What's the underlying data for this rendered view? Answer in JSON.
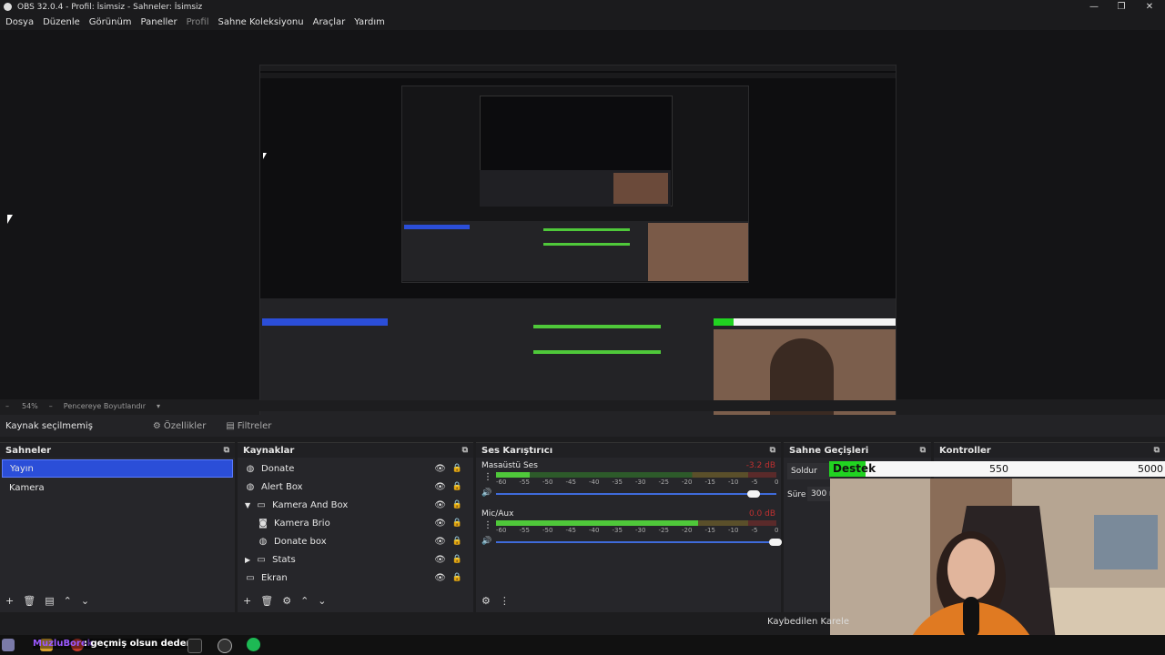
{
  "window": {
    "title": "OBS 32.0.4 - Profil: İsimsiz - Sahneler: İsimsiz"
  },
  "menu": [
    "Dosya",
    "Düzenle",
    "Görünüm",
    "Paneller",
    "Profil",
    "Sahne Koleksiyonu",
    "Araçlar",
    "Yardım"
  ],
  "zoom": {
    "value": "54%",
    "mode": "Pencereye Boyutlandır"
  },
  "source_bar": {
    "status": "Kaynak seçilmemiş",
    "properties": "Özellikler",
    "filters": "Filtreler"
  },
  "docks": {
    "scenes": {
      "title": "Sahneler",
      "items": [
        "Yayın",
        "Kamera"
      ],
      "selected": "Yayın"
    },
    "sources": {
      "title": "Kaynaklar",
      "items": [
        {
          "label": "Donate",
          "icon": "browser-icon",
          "indent": 0
        },
        {
          "label": "Alert Box",
          "icon": "browser-icon",
          "indent": 0
        },
        {
          "label": "Kamera And Box",
          "icon": "folder-icon",
          "indent": 0,
          "expanded": true
        },
        {
          "label": "Kamera Brio",
          "icon": "camera-icon",
          "indent": 1
        },
        {
          "label": "Donate box",
          "icon": "browser-icon",
          "indent": 1
        },
        {
          "label": "Stats",
          "icon": "folder-icon",
          "indent": 0,
          "expanded": false
        },
        {
          "label": "Ekran",
          "icon": "monitor-icon",
          "indent": 0
        }
      ]
    },
    "mixer": {
      "title": "Ses Karıştırıcı",
      "channels": [
        {
          "name": "Masaüstü Ses",
          "db": "-3.2 dB",
          "level": 0.12,
          "fader": 0.92
        },
        {
          "name": "Mic/Aux",
          "db": "0.0 dB",
          "level": 0.72,
          "fader": 1.0
        }
      ],
      "scale": [
        "-60",
        "-55",
        "-50",
        "-45",
        "-40",
        "-35",
        "-30",
        "-25",
        "-20",
        "-15",
        "-10",
        "-5",
        "0"
      ]
    },
    "transitions": {
      "title": "Sahne Geçişleri",
      "type": "Soldur",
      "duration_label": "Süre",
      "duration": "300 m"
    },
    "controls": {
      "title": "Kontroller"
    }
  },
  "donation_overlay": {
    "label": "Destek",
    "current": "550",
    "goal": "5000"
  },
  "status_bar": {
    "text": "Kaybedilen Karele"
  },
  "chat_strip": {
    "user": "MuzluBorek",
    "message": ": geçmiş olsun dedem"
  },
  "colors": {
    "accent": "#2b4ed8",
    "meter_green": "#4fc83a",
    "meter_yellow": "#c8b23a",
    "meter_red": "#c83a3a",
    "fader_blue": "#3f6bdb"
  }
}
